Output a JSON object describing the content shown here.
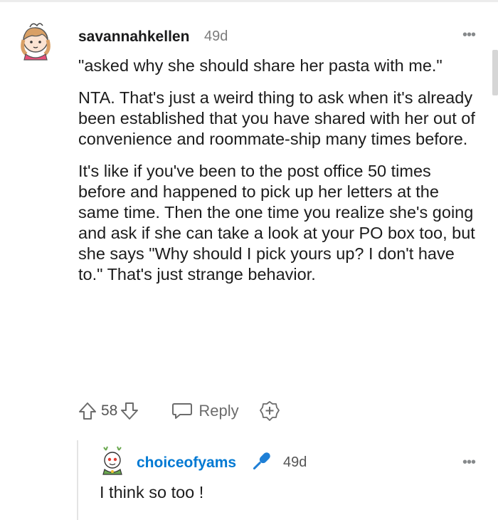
{
  "comment": {
    "username": "savannahkellen",
    "age": "49d",
    "more_label": "•••",
    "paragraphs": [
      "\"asked why she should share her pasta with me.\"",
      "NTA. That's just a weird thing to ask when it's already been established that you have shared with her out of convenience and roommate-ship many times before.",
      "It's like if you've been to the post office 50 times before and happened to pick up her letters at the same time. Then the one time you realize she's going and ask if she can take a look at your PO box too, but she says \"Why should I pick yours up? I don't have to.\" That's just strange behavior."
    ],
    "score": "58",
    "reply_label": "Reply",
    "icons": [
      "upvote-icon",
      "downvote-icon",
      "reply-icon",
      "award-icon",
      "more-icon"
    ]
  },
  "reply": {
    "username": "choiceofyams",
    "age": "49d",
    "more_label": "•••",
    "text": "I think so too !",
    "icons": [
      "microphone-icon",
      "more-icon"
    ]
  },
  "colors": {
    "username_link": "#0079d3",
    "mic_blue": "#1e7fd6",
    "meta_gray": "#7c7c7c",
    "thread_line": "#e4e4e4"
  }
}
